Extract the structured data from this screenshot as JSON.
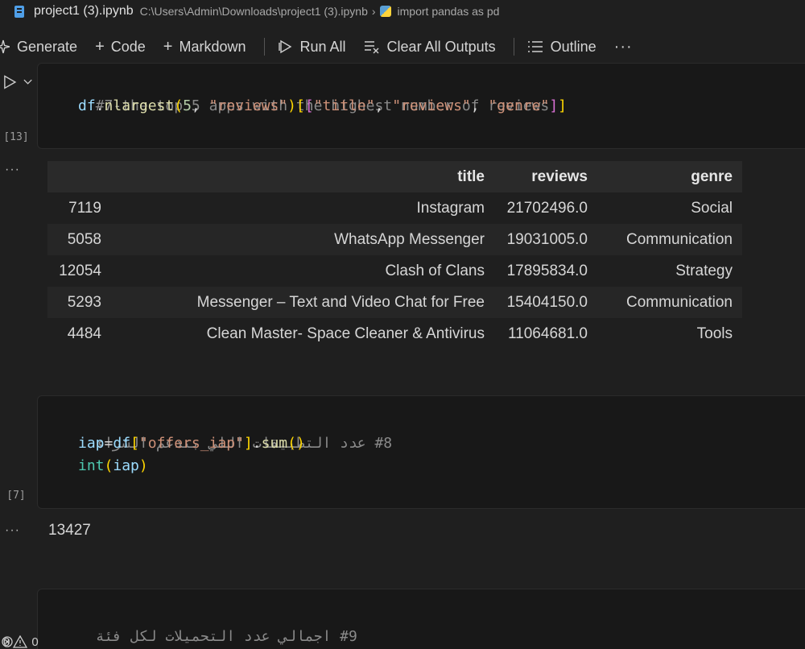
{
  "breadcrumb": {
    "file_name": "project1 (3).ipynb",
    "path": "C:\\Users\\Admin\\Downloads\\project1 (3).ipynb",
    "separator": "›",
    "symbol": "import pandas as pd"
  },
  "toolbar": {
    "generate": "Generate",
    "code": "Code",
    "markdown": "Markdown",
    "run_all": "Run All",
    "clear_outputs": "Clear All Outputs",
    "outline": "Outline",
    "more": "···"
  },
  "cell13": {
    "exec_count": "[13]",
    "line1": "#7-the top 5 apps with the highest number of reviews",
    "line2": {
      "df": "df",
      "dot": ".",
      "fn": "nlargest",
      "open": "(",
      "num": "5",
      "comma1": ", ",
      "arg": "\"reviews\"",
      "close": ")",
      "lb1": "[",
      "lb2": "[",
      "s1": "\"title\"",
      "c1": ", ",
      "s2": "\"reviews\"",
      "c2": ", ",
      "s3": "\"genre\"",
      "rb2": "]",
      "rb1": "]"
    },
    "output": {
      "more": "···",
      "columns": [
        "",
        "title",
        "reviews",
        "genre"
      ],
      "rows": [
        {
          "index": "7119",
          "title": "Instagram",
          "reviews": "21702496.0",
          "genre": "Social"
        },
        {
          "index": "5058",
          "title": "WhatsApp Messenger",
          "reviews": "19031005.0",
          "genre": "Communication"
        },
        {
          "index": "12054",
          "title": "Clash of Clans",
          "reviews": "17895834.0",
          "genre": "Strategy"
        },
        {
          "index": "5293",
          "title": "Messenger – Text and Video Chat for Free",
          "reviews": "15404150.0",
          "genre": "Communication"
        },
        {
          "index": "4484",
          "title": "Clean Master- Space Cleaner & Antivirus",
          "reviews": "11064681.0",
          "genre": "Tools"
        }
      ]
    }
  },
  "cell7": {
    "exec_count": "[7]",
    "line1": "#8 عدد التطبيقات اللي بتدعم الشراء",
    "line2": {
      "var": "iap",
      "eq": "=",
      "df": "df",
      "lb": "[",
      "key": "\"offers_iap\"",
      "rb": "]",
      "dot": ".",
      "fn": "sum",
      "parens": "()"
    },
    "line3": {
      "fn": "int",
      "open": "(",
      "arg": "iap",
      "close": ")"
    },
    "output_more": "···",
    "output": "13427"
  },
  "cell9": {
    "line1": "#9 اجمالي عدد التحميلات لكل فئة"
  },
  "status": {
    "errors": "0",
    "warnings": "0"
  }
}
